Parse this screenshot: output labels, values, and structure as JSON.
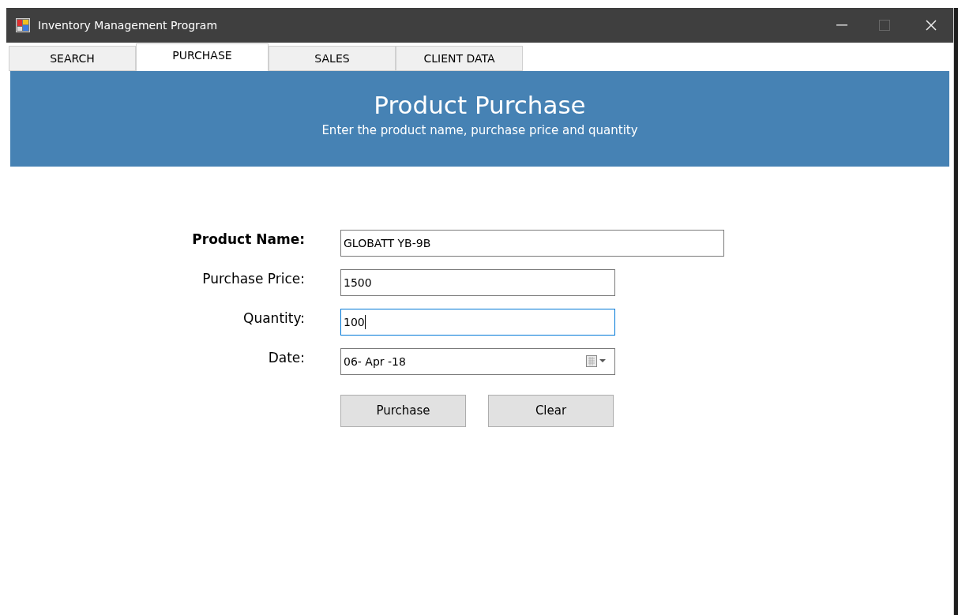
{
  "window": {
    "title": "Inventory Management Program"
  },
  "tabs": [
    {
      "label": "SEARCH",
      "selected": false
    },
    {
      "label": "PURCHASE",
      "selected": true
    },
    {
      "label": "SALES",
      "selected": false
    },
    {
      "label": "CLIENT DATA",
      "selected": false
    }
  ],
  "banner": {
    "title": "Product Purchase",
    "subtitle": "Enter the product name, purchase price and quantity"
  },
  "fields": [
    {
      "label": "Product Name:",
      "value": "GLOBATT YB-9B",
      "kind": "wide",
      "bold": true,
      "focused": false
    },
    {
      "label": "Purchase Price:",
      "value": "1500",
      "kind": "text",
      "bold": false,
      "focused": false
    },
    {
      "label": "Quantity:",
      "value": "100",
      "kind": "text",
      "bold": false,
      "focused": true
    },
    {
      "label": "Date:",
      "value": "06- Apr -18",
      "kind": "date",
      "bold": false,
      "focused": false
    }
  ],
  "buttons": [
    "Purchase",
    "Clear"
  ]
}
